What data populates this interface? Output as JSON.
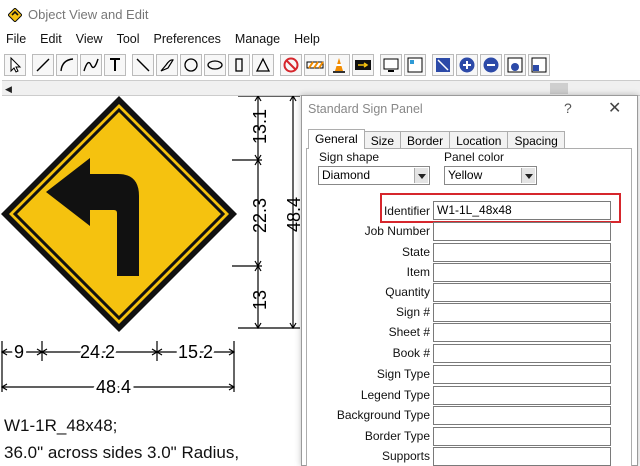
{
  "window": {
    "title": "Object View and Edit"
  },
  "menubar": [
    "File",
    "Edit",
    "View",
    "Tool",
    "Preferences",
    "Manage",
    "Help"
  ],
  "toolbar": {
    "tools": [
      "pointer-icon",
      "line-icon",
      "arc-icon",
      "curve-icon",
      "text-icon",
      "slash-icon",
      "freehand-icon",
      "circle-icon",
      "ellipse-icon",
      "rectangle-icon",
      "triangle-icon",
      "no-symbol-icon",
      "barricade-icon",
      "cone-icon",
      "arrow-board-icon",
      "monitor-icon",
      "panel-icon",
      "fit-view-icon",
      "zoom-in-icon",
      "zoom-out-icon",
      "zoom-window-icon",
      "zoom-extents-icon"
    ]
  },
  "colors": {
    "sign_yellow": "#F5C20F",
    "sign_border": "#111111",
    "highlight": "#D6262C"
  },
  "canvas": {
    "dims": {
      "top": "13.1",
      "middle": "22.3",
      "bottom": "13",
      "height_total": "48.4",
      "left": "9",
      "center": "24.2",
      "right": "15.2",
      "width_total": "48.4"
    },
    "caption_line1": "W1-1R_48x48;",
    "caption_line2": "36.0\" across sides 3.0\" Radius,"
  },
  "dialog": {
    "title": "Standard Sign Panel",
    "help_label": "?",
    "close_label": "✕",
    "tabs": [
      "General",
      "Size",
      "Border",
      "Location",
      "Spacing"
    ],
    "sign_shape_label": "Sign shape",
    "sign_shape_value": "Diamond",
    "panel_color_label": "Panel color",
    "panel_color_value": "Yellow",
    "fields": [
      {
        "label": "Identifier",
        "value": "W1-1L_48x48"
      },
      {
        "label": "Job Number",
        "value": ""
      },
      {
        "label": "State",
        "value": ""
      },
      {
        "label": "Item",
        "value": ""
      },
      {
        "label": "Quantity",
        "value": ""
      },
      {
        "label": "Sign #",
        "value": ""
      },
      {
        "label": "Sheet #",
        "value": ""
      },
      {
        "label": "Book #",
        "value": ""
      },
      {
        "label": "Sign Type",
        "value": ""
      },
      {
        "label": "Legend Type",
        "value": ""
      },
      {
        "label": "Background Type",
        "value": ""
      },
      {
        "label": "Border Type",
        "value": ""
      },
      {
        "label": "Supports",
        "value": ""
      }
    ]
  }
}
